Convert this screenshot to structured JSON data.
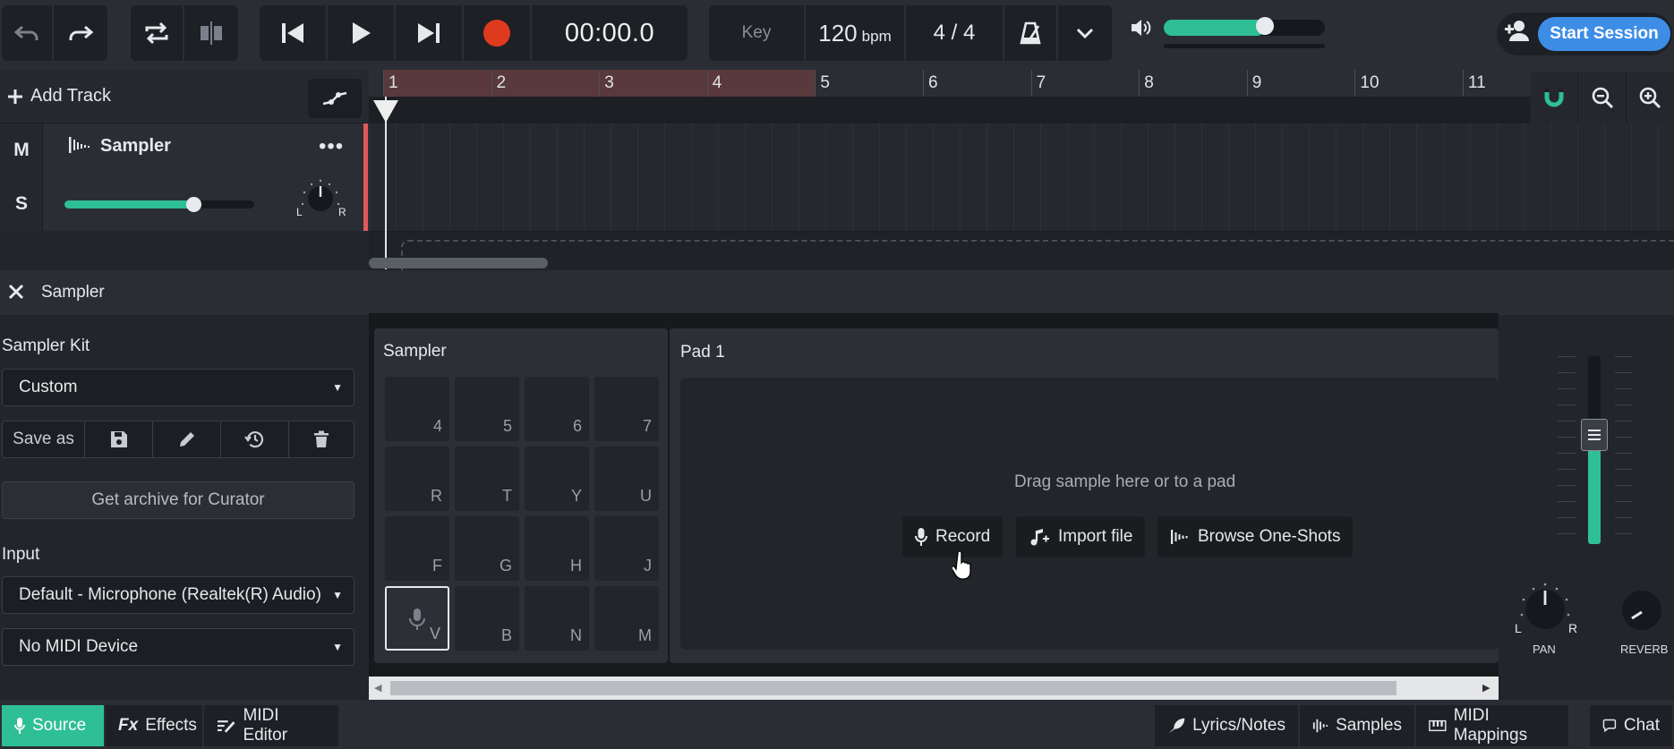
{
  "transport": {
    "time": "00:00.0",
    "key_label": "Key",
    "bpm": "120",
    "bpm_unit": "bpm",
    "time_signature": "4 / 4",
    "master_volume_fraction": 0.63
  },
  "session": {
    "start_label": "Start Session"
  },
  "tracks_header": {
    "add_track_label": "Add Track"
  },
  "ruler": {
    "bars": [
      "1",
      "2",
      "3",
      "4",
      "5",
      "6",
      "7",
      "8",
      "9",
      "10",
      "11"
    ]
  },
  "track": {
    "mute_label": "M",
    "solo_label": "S",
    "name": "Sampler",
    "menu_label": "•••",
    "volume_fraction": 0.68,
    "pan_left": "L",
    "pan_right": "R"
  },
  "device_panel": {
    "title": "Sampler",
    "kit_label": "Sampler Kit",
    "kit_value": "Custom",
    "save_as_label": "Save as",
    "archive_label": "Get archive for Curator",
    "input_label": "Input",
    "input_value": "Default - Microphone (Realtek(R) Audio)",
    "midi_value": "No MIDI Device",
    "sampler_title": "Sampler",
    "pads": [
      "4",
      "5",
      "6",
      "7",
      "R",
      "T",
      "Y",
      "U",
      "F",
      "G",
      "H",
      "J",
      "V",
      "B",
      "N",
      "M"
    ],
    "pad_title": "Pad 1",
    "drop_hint": "Drag sample here or to a pad",
    "record_label": "Record",
    "import_label": "Import file",
    "browse_label": "Browse One-Shots",
    "pan_label": "PAN",
    "pan_left": "L",
    "pan_right": "R",
    "reverb_label": "REVERB",
    "fader_level": 0.58
  },
  "bottom_tabs": {
    "source": "Source",
    "effects": "Effects",
    "effects_prefix": "Fx",
    "midi_editor": "MIDI Editor",
    "lyrics": "Lyrics/Notes",
    "samples": "Samples",
    "midi_mappings": "MIDI Mappings",
    "chat": "Chat"
  },
  "colors": {
    "accent": "#2fbf95",
    "record": "#e03a1e",
    "session_button": "#3d8de6",
    "track_accent": "#e05a5a"
  }
}
